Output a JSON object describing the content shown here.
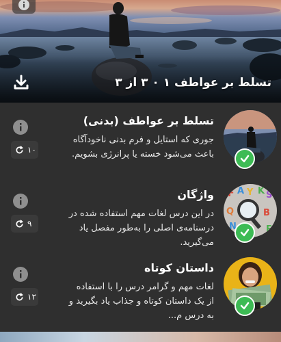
{
  "hero": {
    "title": "تسلط بر عواطف ۱ ۰ ۳ از ۳",
    "info_icon": "info-icon",
    "download_icon": "download-icon"
  },
  "lessons": [
    {
      "title": "تسلط بر عواطف (بدنی)",
      "description": "جوری که استایل و فرم بدنی ناخودآگاه باعث می‌شود خسته یا پرانرژی بشویم.",
      "repeat_count": "۱۰",
      "completed": true
    },
    {
      "title": "واژگان",
      "description": "در این درس لغات مهم استفاده شده در درسنامه‌ی اصلی را به‌طور مفصل یاد می‌گیرید.",
      "repeat_count": "۹",
      "completed": true
    },
    {
      "title": "داستان کوتاه",
      "description": "لغات مهم و گرامر درس را با استفاده از یک داستان کوتاه و جذاب یاد بگیرید و به درس م...",
      "repeat_count": "۱۲",
      "completed": true
    }
  ],
  "colors": {
    "background": "#2f2f2f",
    "check": "#3dbb54",
    "info": "#8f8f8f"
  }
}
